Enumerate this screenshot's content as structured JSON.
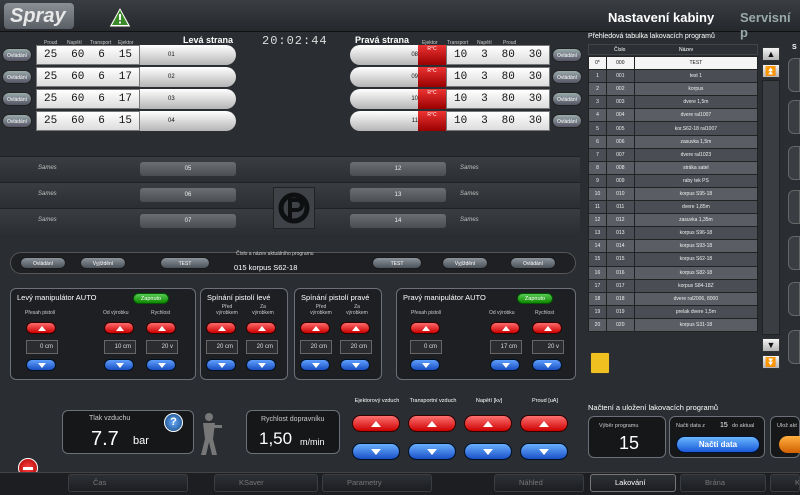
{
  "header": {
    "logo": "Spray",
    "title": "Nastavení kabiny",
    "tab_service": "Servisní p",
    "clock": "20:02:44"
  },
  "left": {
    "title": "Levá strana",
    "cols": [
      "Proud",
      "Napětí",
      "Transport",
      "Ejektor"
    ],
    "btn": "Ovládání",
    "guns": [
      {
        "n": "01",
        "v": [
          "25",
          "60",
          "6",
          "15"
        ]
      },
      {
        "n": "02",
        "v": [
          "25",
          "60",
          "6",
          "17"
        ]
      },
      {
        "n": "03",
        "v": [
          "25",
          "60",
          "6",
          "17"
        ]
      },
      {
        "n": "04",
        "v": [
          "25",
          "60",
          "6",
          "15"
        ]
      }
    ],
    "inactive": [
      "05",
      "06",
      "07"
    ],
    "brand": "Sames",
    "tag": "R°C"
  },
  "right": {
    "title": "Pravá strana",
    "cols": [
      "Ejektor",
      "Transport",
      "Napětí",
      "Proud"
    ],
    "btn": "Ovládání",
    "guns": [
      {
        "n": "08",
        "v": [
          "10",
          "3",
          "80",
          "30"
        ]
      },
      {
        "n": "09",
        "v": [
          "10",
          "3",
          "80",
          "30"
        ]
      },
      {
        "n": "10",
        "v": [
          "10",
          "3",
          "80",
          "30"
        ]
      },
      {
        "n": "11",
        "v": [
          "10",
          "3",
          "80",
          "30"
        ]
      }
    ],
    "inactive": [
      "12",
      "13",
      "14"
    ]
  },
  "program": {
    "label": "Číslo a název aktuálního programu",
    "value": "015  korpus S62-18",
    "pills": [
      "Ovládání",
      "Vyjíždění",
      "TEST",
      "TEST",
      "Vyjíždění",
      "Ovládání"
    ]
  },
  "lman": {
    "title": "Levý manipulátor  AUTO",
    "btn": "Zapnuto",
    "l1": "Přesah pistolí",
    "l2": "Od výrobku",
    "l3": "Rychlost",
    "v": [
      "0 cm",
      "10 cm",
      "20 v"
    ]
  },
  "spl": {
    "title": "Spínání pistolí levé",
    "l1": "Před výrobkem",
    "l2": "Za výrobkem",
    "v": [
      "20 cm",
      "20 cm"
    ]
  },
  "spr": {
    "title": "Spínání pistolí pravé",
    "l1": "Před výrobkem",
    "l2": "Za výrobkem",
    "v": [
      "20 cm",
      "20 cm"
    ]
  },
  "rman": {
    "title": "Pravý manipulátor  AUTO",
    "btn": "Zapnuto",
    "l1": "Přesah pistolí",
    "l2": "Od výrobku",
    "l3": "Rychlost",
    "v": [
      "0 cm",
      "17 cm",
      "20 v"
    ]
  },
  "air": {
    "label": "Tlak vzduchu",
    "value": "7.7",
    "unit": "bar",
    "help": "?"
  },
  "conv": {
    "label": "Rychlost dopravníku",
    "value": "1,50",
    "unit": "m/min"
  },
  "adj": [
    "Ejektorový vzduch",
    "Transportní vzduch",
    "Napětí [kv]",
    "Proud [uA]"
  ],
  "table": {
    "title": "Přehledová tabulka lakovacích programů",
    "h": [
      "Číslo",
      "Název"
    ],
    "rows": [
      [
        "0*",
        "000",
        "TEST"
      ],
      [
        "1",
        "001",
        "test 1"
      ],
      [
        "2",
        "002",
        "korpus"
      ],
      [
        "3",
        "003",
        "dvere 1,5m"
      ],
      [
        "4",
        "004",
        "dvere ral1007"
      ],
      [
        "5",
        "005",
        "kor.S62-18 ral1007"
      ],
      [
        "6",
        "006",
        "zasuvka 1,5m"
      ],
      [
        "7",
        "007",
        "dvere ral1023"
      ],
      [
        "8",
        "008",
        "stráka satel"
      ],
      [
        "9",
        "009",
        "raby tek PS"
      ],
      [
        "10",
        "010",
        "korpus S95-18"
      ],
      [
        "11",
        "011",
        "dvere 1,85m"
      ],
      [
        "12",
        "012",
        "zasuvka 1,35m"
      ],
      [
        "13",
        "013",
        "korpus S96-18"
      ],
      [
        "14",
        "014",
        "korpus S93-18"
      ],
      [
        "15",
        "015",
        "korpus S62-18"
      ],
      [
        "16",
        "016",
        "korpus S82-18"
      ],
      [
        "17",
        "017",
        "korpus S84-18Z"
      ],
      [
        "18",
        "018",
        "dvere ral2006, 8000"
      ],
      [
        "19",
        "019",
        "prelak dvere 1,5m"
      ],
      [
        "20",
        "020",
        "korpus S31-18"
      ]
    ]
  },
  "load": {
    "title": "Načtení a uložení lakovacích programů",
    "sel_label": "Výběr programu",
    "sel_value": "15",
    "read_label": "Načti data z",
    "read_from": "15",
    "read_to": "do aktual",
    "read_btn": "Načti data",
    "save_label": "Ulož akt"
  },
  "side": {
    "letter": "S"
  },
  "bottom": [
    "Čas",
    "KSaver",
    "Parametry",
    "Náhled",
    "Lakování",
    "Brána",
    "Kalibrace"
  ]
}
